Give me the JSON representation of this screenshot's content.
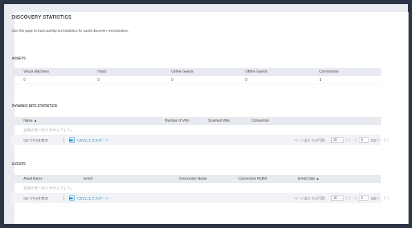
{
  "page": {
    "title": "DISCOVERY STATISTICS",
    "description": "Use this page to track activity and statistics for asset discovery mechanisms."
  },
  "assets": {
    "heading": "ASSETS",
    "columns": [
      "Virtual Machines",
      "Hosts",
      "Online Guests",
      "Offline Guests",
      "Connections"
    ],
    "values": [
      "0",
      "0",
      "0",
      "0",
      "1"
    ]
  },
  "dynamic": {
    "heading": "DYNAMIC SITE STATISTICS",
    "columns": [
      "Name ▲",
      "Number of VMs",
      "Scanned VMs",
      "Connection"
    ],
    "empty_message": "記録が見つかりませんでした。",
    "pager": {
      "count_text": "0のうち0を表示",
      "export_label": "CSVにエクスポート",
      "rows_label": "ページあたりの行数:",
      "rows_value": "10",
      "page_value": "0",
      "page_of": "0の"
    }
  },
  "events": {
    "heading": "EVENTS",
    "columns": [
      "Asset Name",
      "Event",
      "Connection Name",
      "Connection FQDN",
      "Event Date ▲"
    ],
    "empty_message": "記録が見つかりませんでした。",
    "pager": {
      "count_text": "0のうち0を表示",
      "export_label": "CSVにエクスポート",
      "rows_label": "ページあたりの行数:",
      "rows_value": "10",
      "page_value": "0",
      "page_of": "0の"
    }
  },
  "icons": {
    "export": "csv-export-icon",
    "dropdown": "chevron-down-icon",
    "first": "first-page-icon",
    "prev": "prev-page-icon",
    "next": "next-page-icon",
    "last": "last-page-icon"
  },
  "colors": {
    "page_background": "#2b3545",
    "link": "#1f8fd6",
    "header_row": "#e7eaee"
  }
}
